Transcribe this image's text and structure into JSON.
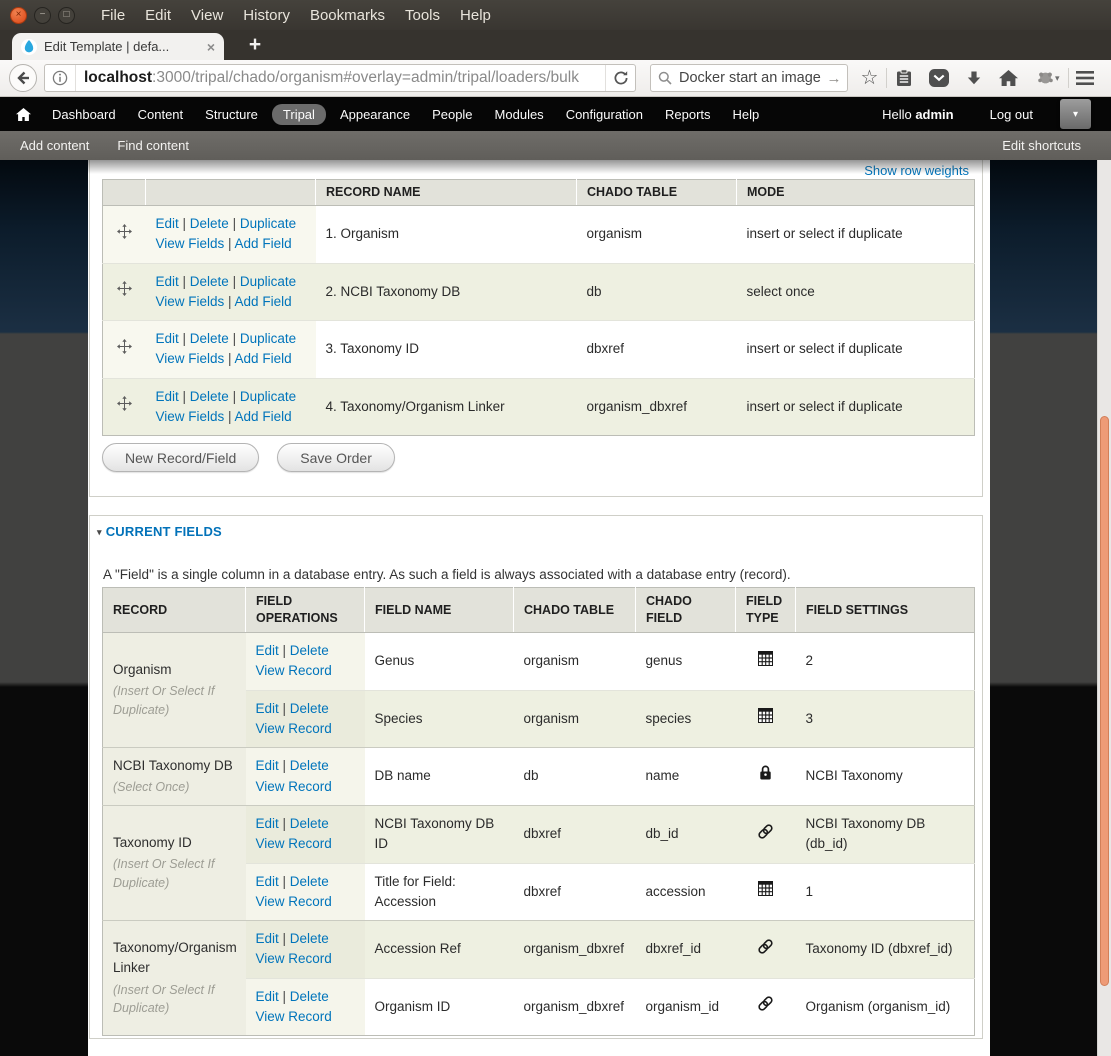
{
  "window": {
    "menu_items": [
      "File",
      "Edit",
      "View",
      "History",
      "Bookmarks",
      "Tools",
      "Help"
    ],
    "tab_title": "Edit Template | defa...",
    "icons": {
      "close_window": "×",
      "minimize_window": "−",
      "maximize_window": "□",
      "tab_close": "×",
      "new_tab": "+",
      "caret_down": "▾",
      "search_arrow": "→",
      "star": "☆"
    }
  },
  "browser": {
    "url_host": "localhost",
    "url_rest": ":3000/tripal/chado/organism#overlay=admin/tripal/loaders/bulk",
    "search_value": "Docker start an image"
  },
  "admin_bar": {
    "items": [
      "Dashboard",
      "Content",
      "Structure",
      "Tripal",
      "Appearance",
      "People",
      "Modules",
      "Configuration",
      "Reports",
      "Help"
    ],
    "active_item": "Tripal",
    "greeting_prefix": "Hello ",
    "username": "admin",
    "logout_label": "Log out"
  },
  "shortcut_bar": {
    "items": [
      "Add content",
      "Find content"
    ],
    "edit_label": "Edit shortcuts"
  },
  "overlay": {
    "show_row_weights": "Show row weights",
    "records_table": {
      "headers": [
        "",
        "",
        "RECORD NAME",
        "CHADO TABLE",
        "MODE"
      ],
      "ops_line1": [
        "Edit",
        "Delete",
        "Duplicate"
      ],
      "ops_line2": [
        "View Fields",
        "Add Field"
      ],
      "rows": [
        {
          "name": "1. Organism",
          "chado_table": "organism",
          "mode": "insert or select if duplicate"
        },
        {
          "name": "2. NCBI Taxonomy DB",
          "chado_table": "db",
          "mode": "select once"
        },
        {
          "name": "3. Taxonomy ID",
          "chado_table": "dbxref",
          "mode": "insert or select if duplicate"
        },
        {
          "name": "4. Taxonomy/Organism Linker",
          "chado_table": "organism_dbxref",
          "mode": "insert or select if duplicate"
        }
      ]
    },
    "buttons": [
      "New Record/Field",
      "Save Order"
    ],
    "fields_section": {
      "legend": "CURRENT FIELDS",
      "description": "A \"Field\" is a single column in a database entry. As such a field is always associated with a database entry (record).",
      "table": {
        "headers": [
          "RECORD",
          "FIELD OPERATIONS",
          "FIELD NAME",
          "CHADO TABLE",
          "CHADO FIELD",
          "FIELD TYPE",
          "FIELD SETTINGS"
        ],
        "ops_line1": [
          "Edit",
          "Delete"
        ],
        "ops_line2": [
          "View Record"
        ],
        "groups": [
          {
            "record": "Organism",
            "note": "(Insert Or Select If Duplicate)",
            "fields": [
              {
                "name": "Genus",
                "chado_table": "organism",
                "chado_field": "genus",
                "type": "grid",
                "settings": "2"
              },
              {
                "name": "Species",
                "chado_table": "organism",
                "chado_field": "species",
                "type": "grid",
                "settings": "3"
              }
            ]
          },
          {
            "record": "NCBI Taxonomy DB",
            "note": "(Select Once)",
            "fields": [
              {
                "name": "DB name",
                "chado_table": "db",
                "chado_field": "name",
                "type": "lock",
                "settings": "NCBI Taxonomy"
              }
            ]
          },
          {
            "record": "Taxonomy ID",
            "note": "(Insert Or Select If Duplicate)",
            "fields": [
              {
                "name": "NCBI Taxonomy DB ID",
                "chado_table": "dbxref",
                "chado_field": "db_id",
                "type": "link",
                "settings": "NCBI Taxonomy DB (db_id)"
              },
              {
                "name": "Title for Field: Accession",
                "chado_table": "dbxref",
                "chado_field": "accession",
                "type": "grid",
                "settings": "1"
              }
            ]
          },
          {
            "record": "Taxonomy/Organism Linker",
            "note": "(Insert Or Select If Duplicate)",
            "fields": [
              {
                "name": "Accession Ref",
                "chado_table": "organism_dbxref",
                "chado_field": "dbxref_id",
                "type": "link",
                "settings": "Taxonomy ID (dbxref_id)"
              },
              {
                "name": "Organism ID",
                "chado_table": "organism_dbxref",
                "chado_field": "organism_id",
                "type": "link",
                "settings": "Organism (organism_id)"
              }
            ]
          }
        ]
      }
    }
  },
  "colors": {
    "link_blue": "#0074bb",
    "legend_blue": "#0272b9",
    "admin_bar_black": "#060606",
    "active_pill_gray": "#6b6b6b",
    "row_stripe_green": "#eef0e1",
    "scrollbar_thumb_orange": "#ee9b77",
    "close_button_orange": "#da4616"
  }
}
